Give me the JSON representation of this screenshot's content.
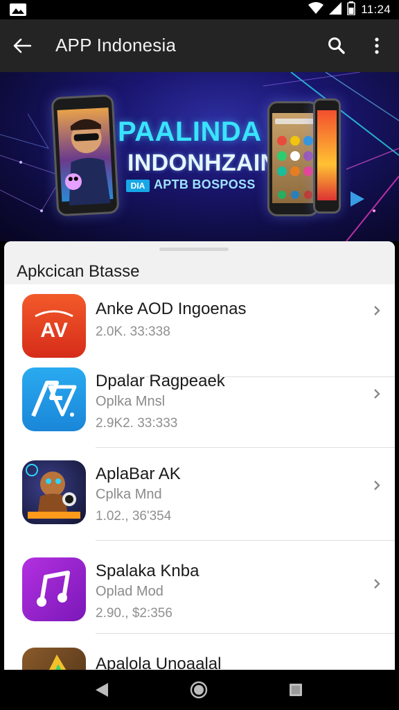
{
  "status_bar": {
    "time": "11:24",
    "icons": [
      "image-icon",
      "wifi-icon",
      "signal-icon",
      "battery-icon"
    ]
  },
  "toolbar": {
    "title": "APP Indonesia",
    "icons": [
      "back-arrow-icon",
      "search-icon",
      "more-vert-icon"
    ]
  },
  "banner": {
    "title_line1": "PAALINDA",
    "title_line2": "INDONHZAIN",
    "badge": "DIA",
    "subtitle": "APTB BOSPOSS"
  },
  "section": {
    "title": "Apkcican Btasse"
  },
  "apps": [
    {
      "name": "Anke AOD Ingoenas",
      "subtitle": "",
      "meta": "2.0K. 33:338",
      "icon": "av-logo-icon",
      "icon_bg": "#e43a21"
    },
    {
      "name": "Dpalar Ragpeaek",
      "subtitle": "Oplka Mnsl",
      "meta": "2.9K2. 33:333",
      "icon": "av-blue-logo-icon",
      "icon_bg": "#1e9be9"
    },
    {
      "name": "AplaBar AK",
      "subtitle": "Cplka Mnd",
      "meta": "1.02., 36'354",
      "icon": "game-character-icon",
      "icon_bg": "#1b1f4a"
    },
    {
      "name": "Spalaka Knba",
      "subtitle": "Oplad Mod",
      "meta": "2.90., $2:356",
      "icon": "music-note-icon",
      "icon_bg": "#8e1fc4"
    },
    {
      "name": "Apalola Unoaalal",
      "subtitle": "",
      "meta": "",
      "icon": "colorful-app-icon",
      "icon_bg": "#6a4a2a"
    }
  ],
  "nav_bar": {
    "icons": [
      "nav-back-icon",
      "nav-home-icon",
      "nav-recents-icon"
    ]
  }
}
